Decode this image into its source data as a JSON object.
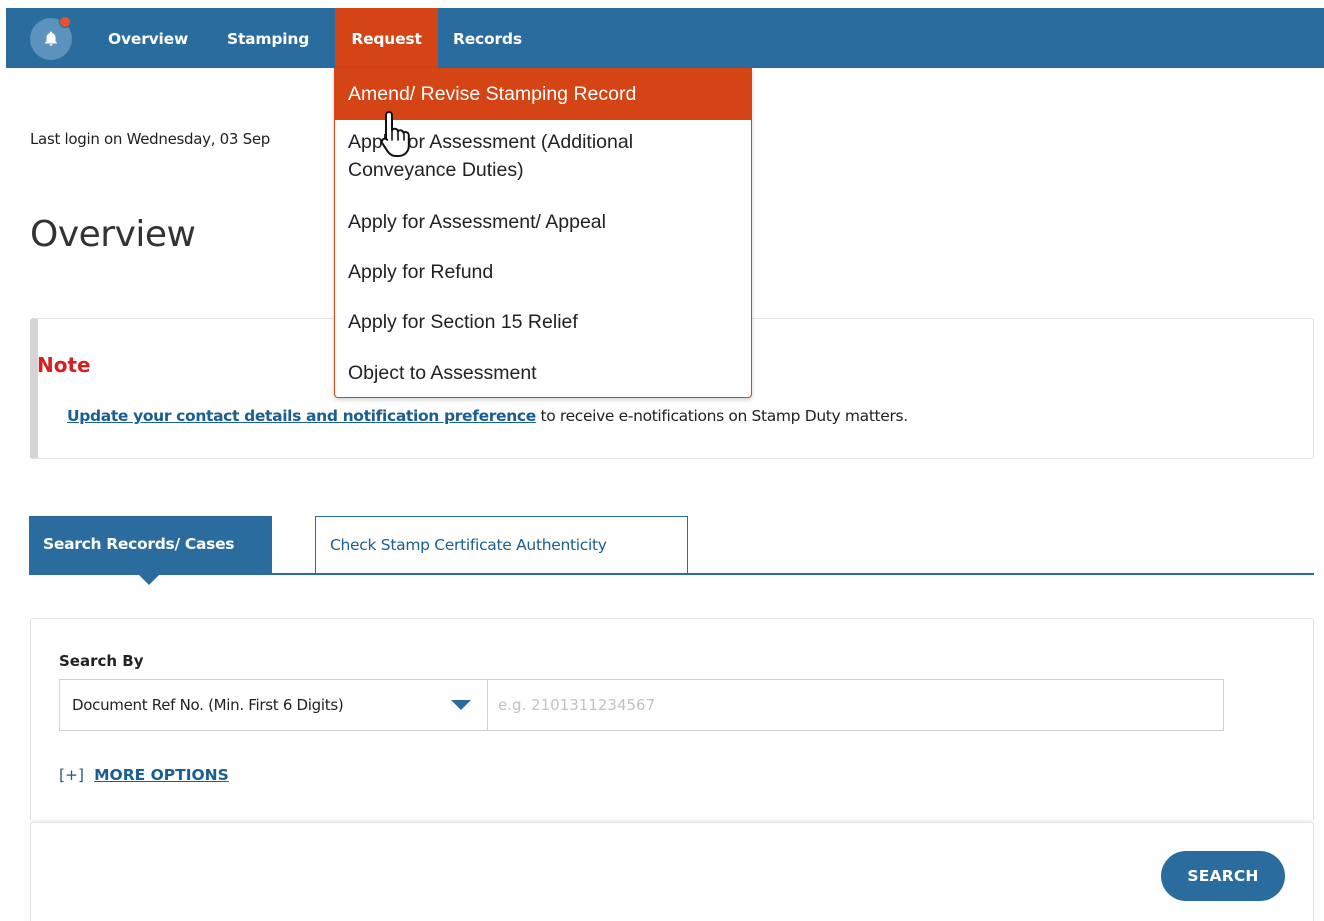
{
  "nav": {
    "items": [
      {
        "label": "Overview"
      },
      {
        "label": "Stamping"
      },
      {
        "label": "Request"
      },
      {
        "label": "Records"
      }
    ],
    "notification_icon": "bell-icon",
    "notification_badge_color": "#e8532e"
  },
  "request_menu": {
    "items": [
      {
        "label": "Amend/ Revise Stamping Record"
      },
      {
        "label": "Apply for Assessment (Additional Conveyance Duties)"
      },
      {
        "label": "Apply for Assessment/ Appeal"
      },
      {
        "label": "Apply for Refund"
      },
      {
        "label": "Apply for Section 15 Relief"
      },
      {
        "label": "Object to Assessment"
      }
    ],
    "highlighted_index": 0
  },
  "last_login": "Last login on Wednesday, 03 Sep",
  "page_title": "Overview",
  "note": {
    "title": "Note",
    "link_text": "Update your contact details and notification preference",
    "text": " to receive e-notifications on Stamp Duty matters."
  },
  "tabs": [
    {
      "label": "Search Records/ Cases",
      "active": true
    },
    {
      "label": "Check Stamp Certificate Authenticity",
      "active": false
    }
  ],
  "search": {
    "by_label": "Search By",
    "by_value": "Document Ref No. (Min. First 6 Digits)",
    "placeholder": "e.g. 2101311234567",
    "more_options_prefix": "[+]",
    "more_options_label": "MORE OPTIONS",
    "button_label": "SEARCH"
  },
  "colors": {
    "brand_blue": "#2a6c9e",
    "accent_orange": "#d54415",
    "note_red": "#d42020"
  }
}
